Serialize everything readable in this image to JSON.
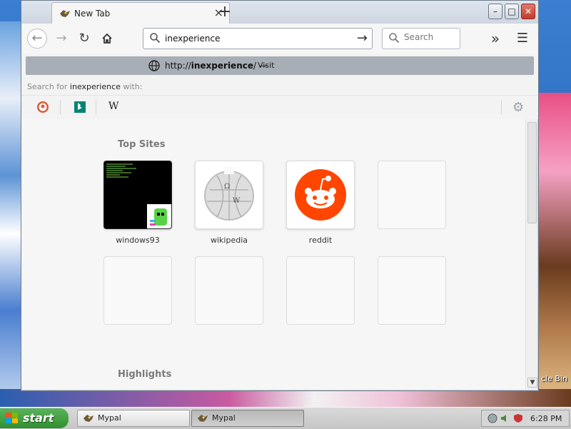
{
  "browser": {
    "tab": {
      "title": "New Tab"
    },
    "new_tab_label": "+",
    "window_controls": {
      "minimize": "–",
      "maximize": "□",
      "close": "✕"
    },
    "url_input": {
      "value": "inexperience"
    },
    "search": {
      "placeholder": "Search"
    },
    "suggestion": {
      "url_prefix": "http://",
      "url_host": "inexperience",
      "url_suffix": "/",
      "dash": "—",
      "action": "Visit"
    },
    "search_for": {
      "prefix": "Search for",
      "query": "inexperience",
      "suffix": "with:"
    },
    "engines": [
      {
        "name": "DuckDuckGo",
        "icon": "duckduckgo-icon"
      },
      {
        "name": "Bing",
        "icon": "bing-icon"
      },
      {
        "name": "Wikipedia",
        "icon": "wikipedia-icon",
        "glyph": "W"
      }
    ]
  },
  "newtab": {
    "top_sites_title": "Top Sites",
    "highlights_title": "Highlights",
    "tiles": [
      {
        "label": "windows93"
      },
      {
        "label": "wikipedia"
      },
      {
        "label": "reddit"
      },
      {
        "label": ""
      },
      {
        "label": ""
      },
      {
        "label": ""
      },
      {
        "label": ""
      },
      {
        "label": ""
      }
    ]
  },
  "desktop": {
    "recycle_bin_label": "cle Bin"
  },
  "taskbar": {
    "start_label": "start",
    "tasks": [
      {
        "label": "Mypal",
        "active": false
      },
      {
        "label": "Mypal",
        "active": true
      }
    ],
    "clock": "6:28 PM"
  },
  "colors": {
    "reddit_orange": "#ff4500",
    "start_green": "#2f8f2f",
    "close_red": "#c33c2b",
    "suggestion_highlight": "#a8aeb6"
  }
}
